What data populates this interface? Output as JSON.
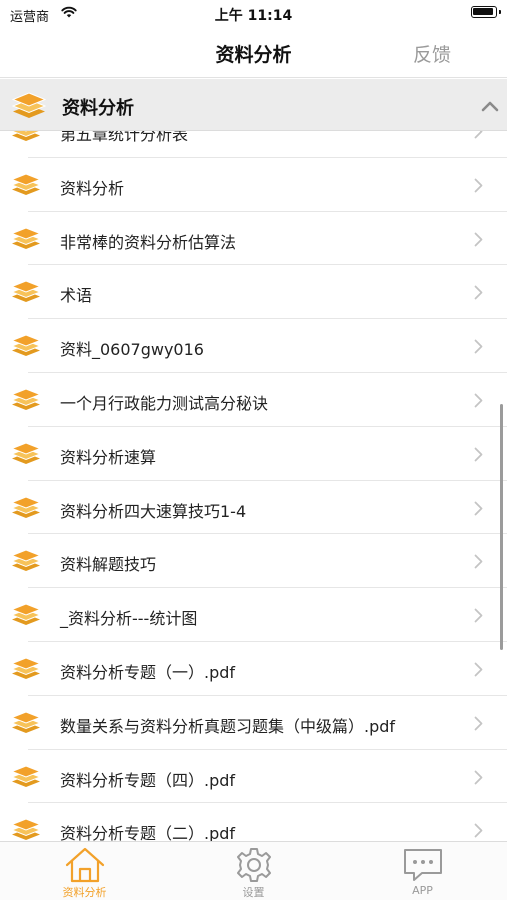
{
  "status_bar": {
    "carrier": "运营商",
    "time": "上午 11:14"
  },
  "nav": {
    "title": "资料分析",
    "feedback": "反馈"
  },
  "section": {
    "title": "资料分析",
    "icon": "layers-icon",
    "state_icon": "chevron-up-icon"
  },
  "list": {
    "icon": "layers-icon",
    "items": [
      {
        "label": "第五章统计分析表"
      },
      {
        "label": "资料分析"
      },
      {
        "label": "非常棒的资料分析估算法"
      },
      {
        "label": "术语"
      },
      {
        "label": "资料_0607gwy016"
      },
      {
        "label": "一个月行政能力测试高分秘诀"
      },
      {
        "label": "资料分析速算"
      },
      {
        "label": "资料分析四大速算技巧1-4"
      },
      {
        "label": "资料解题技巧"
      },
      {
        "label": "_资料分析---统计图"
      },
      {
        "label": "资料分析专题（一）.pdf"
      },
      {
        "label": "数量关系与资料分析真题习题集（中级篇）.pdf"
      },
      {
        "label": "资料分析专题（四）.pdf"
      },
      {
        "label": "资料分析专题（二）.pdf"
      }
    ]
  },
  "tabs": [
    {
      "label": "资料分析",
      "icon": "home-icon",
      "active": true
    },
    {
      "label": "设置",
      "icon": "gear-icon",
      "active": false
    },
    {
      "label": "APP",
      "icon": "chat-bubble-icon",
      "active": false
    }
  ],
  "colors": {
    "accent": "#f2a12a",
    "layers_dark": "#e39a1f",
    "layers_light": "#f7c35a",
    "header_bg": "#ececec",
    "inactive": "#9a9a9a"
  }
}
